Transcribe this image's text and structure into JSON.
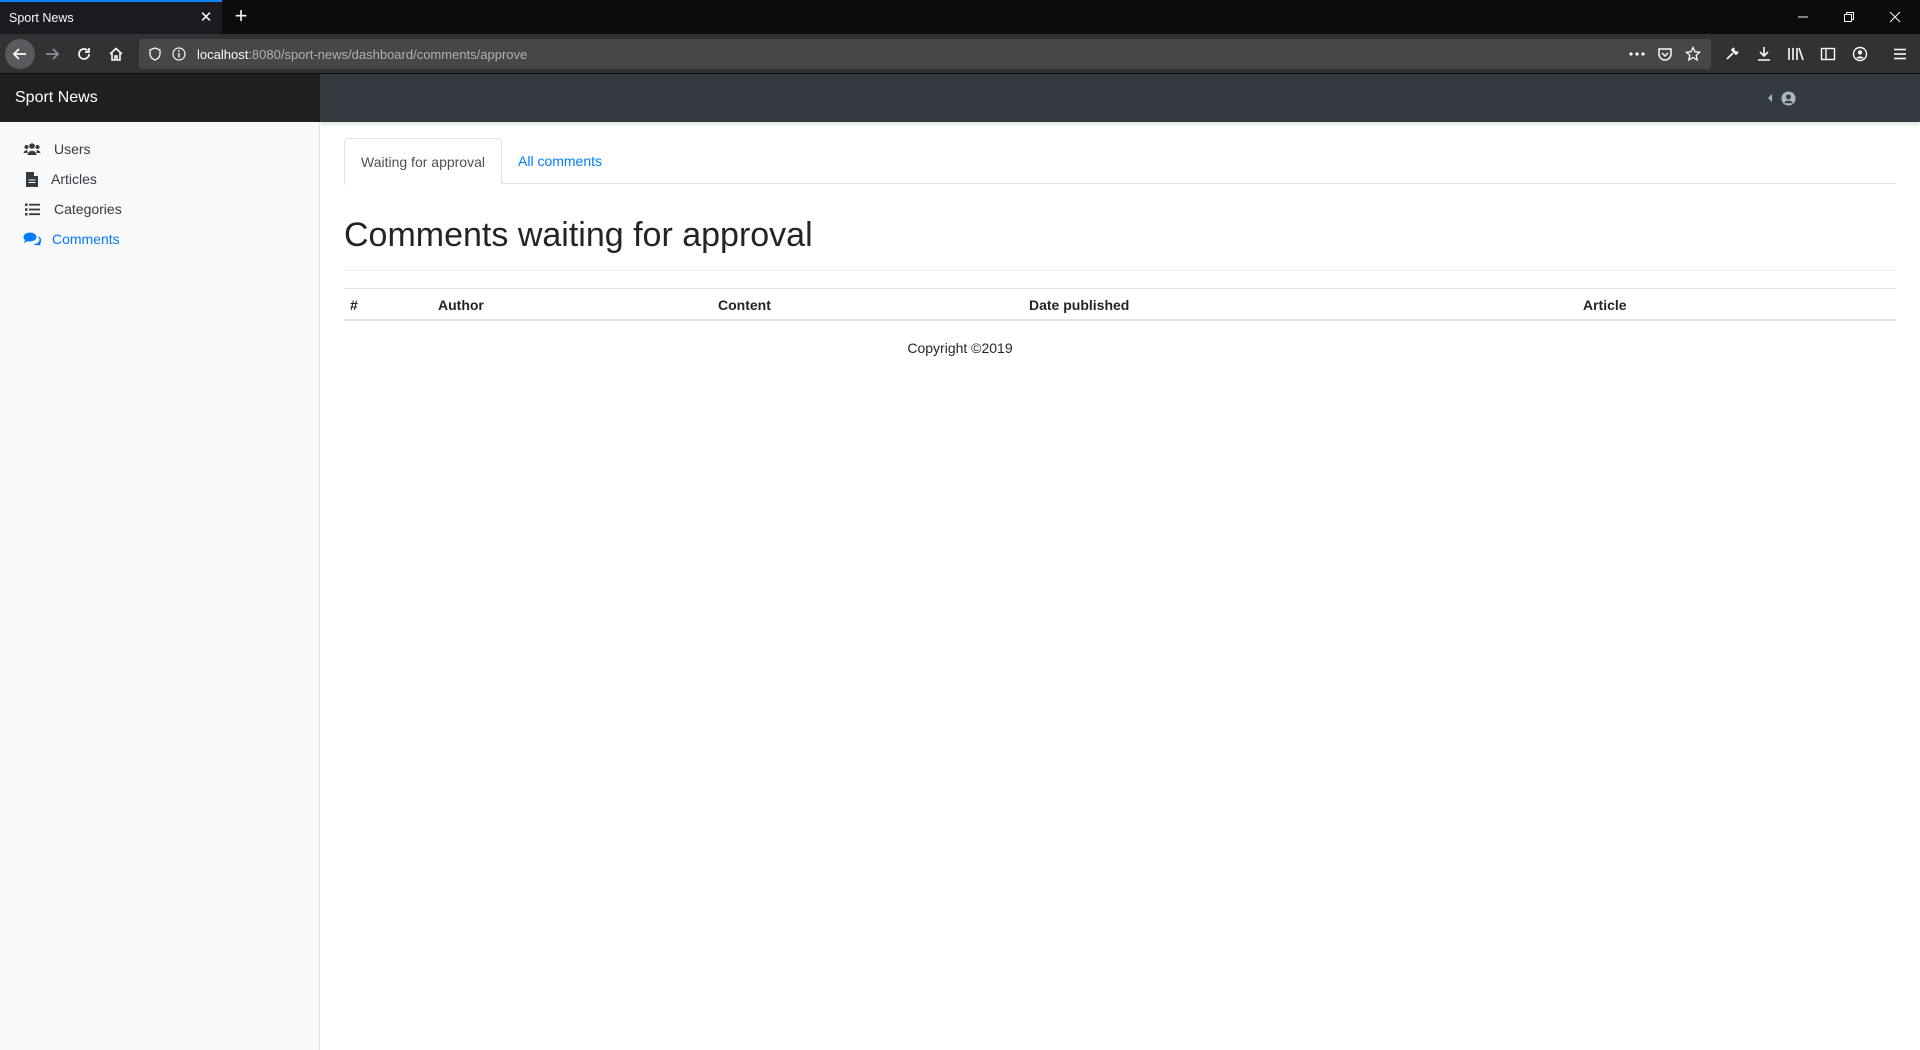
{
  "browser": {
    "tab_title": "Sport News",
    "url_host": "localhost",
    "url_path": ":8080/sport-news/dashboard/comments/approve"
  },
  "app": {
    "brand": "Sport News"
  },
  "sidebar": {
    "items": [
      {
        "label": "Users",
        "icon": "users-icon",
        "active": false
      },
      {
        "label": "Articles",
        "icon": "file-icon",
        "active": false
      },
      {
        "label": "Categories",
        "icon": "list-icon",
        "active": false
      },
      {
        "label": "Comments",
        "icon": "comments-icon",
        "active": true
      }
    ]
  },
  "tabs": [
    {
      "label": "Waiting for approval",
      "active": true
    },
    {
      "label": "All comments",
      "active": false
    }
  ],
  "page": {
    "title": "Comments waiting for approval"
  },
  "table": {
    "columns": [
      "#",
      "Author",
      "Content",
      "Date published",
      "Article"
    ],
    "rows": []
  },
  "footer": {
    "text": "Copyright ©2019"
  },
  "colors": {
    "accent": "#007bff",
    "topbar": "#343a40",
    "brand_bg": "#1e1f21",
    "sidebar_bg": "#f8f9fa"
  }
}
